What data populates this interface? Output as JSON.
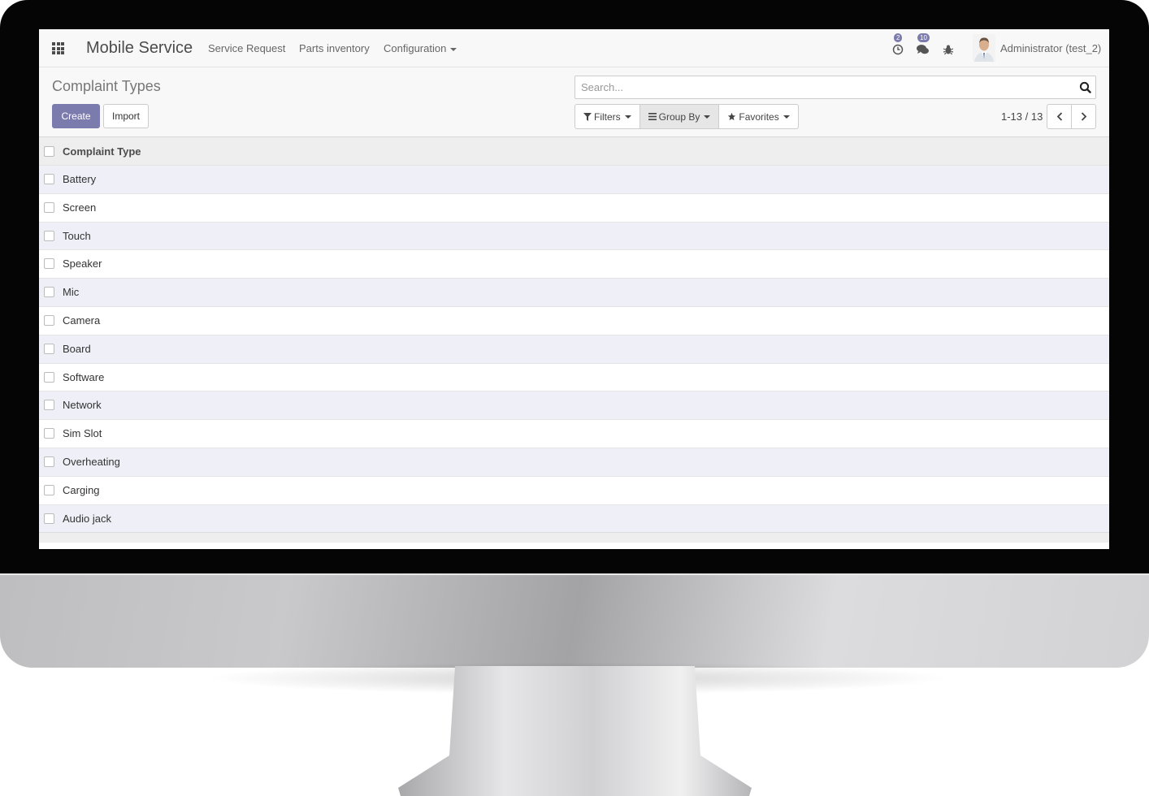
{
  "app": {
    "title": "Mobile Service"
  },
  "nav": {
    "items": [
      {
        "label": "Service Request"
      },
      {
        "label": "Parts inventory"
      },
      {
        "label": "Configuration"
      }
    ]
  },
  "systray": {
    "activity_count": "2",
    "messages_count": "10",
    "user": "Administrator (test_2)"
  },
  "page": {
    "title": "Complaint Types",
    "create_label": "Create",
    "import_label": "Import"
  },
  "search": {
    "placeholder": "Search..."
  },
  "filters": {
    "filters_label": "Filters",
    "groupby_label": "Group By",
    "favorites_label": "Favorites"
  },
  "pager": {
    "text": "1-13 / 13"
  },
  "list": {
    "column_header": "Complaint Type",
    "rows": [
      "Battery",
      "Screen",
      "Touch",
      "Speaker",
      "Mic",
      "Camera",
      "Board",
      "Software",
      "Network",
      "Sim Slot",
      "Overheating",
      "Carging",
      "Audio jack"
    ]
  },
  "colors": {
    "accent": "#7c7bad",
    "row_alt": "#efeff7"
  }
}
